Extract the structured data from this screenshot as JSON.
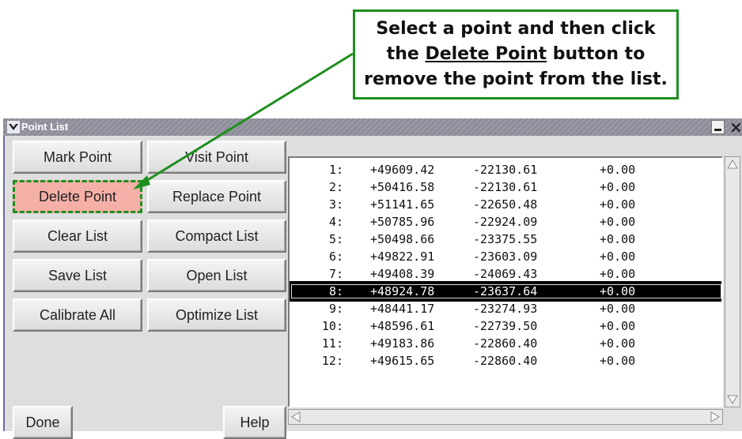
{
  "callout": {
    "line1": "Select a point and then click",
    "line2_before": "the ",
    "line2_link": "Delete Point",
    "line2_after": " button to",
    "line3": "remove the point from the list."
  },
  "window": {
    "title": "Point List",
    "close_glyph": "×"
  },
  "buttons": {
    "mark_point": "Mark Point",
    "visit_point": "Visit Point",
    "delete_point": "Delete Point",
    "replace_point": "Replace Point",
    "clear_list": "Clear List",
    "compact_list": "Compact List",
    "save_list": "Save List",
    "open_list": "Open List",
    "calibrate_all": "Calibrate All",
    "optimize_list": "Optimize List",
    "done": "Done",
    "help": "Help"
  },
  "points": [
    {
      "idx": "1:",
      "x": "+49609.42",
      "y": "-22130.61",
      "z": "+0.00"
    },
    {
      "idx": "2:",
      "x": "+50416.58",
      "y": "-22130.61",
      "z": "+0.00"
    },
    {
      "idx": "3:",
      "x": "+51141.65",
      "y": "-22650.48",
      "z": "+0.00"
    },
    {
      "idx": "4:",
      "x": "+50785.96",
      "y": "-22924.09",
      "z": "+0.00"
    },
    {
      "idx": "5:",
      "x": "+50498.66",
      "y": "-23375.55",
      "z": "+0.00"
    },
    {
      "idx": "6:",
      "x": "+49822.91",
      "y": "-23603.09",
      "z": "+0.00"
    },
    {
      "idx": "7:",
      "x": "+49408.39",
      "y": "-24069.43",
      "z": "+0.00"
    },
    {
      "idx": "8:",
      "x": "+48924.78",
      "y": "-23637.64",
      "z": "+0.00"
    },
    {
      "idx": "9:",
      "x": "+48441.17",
      "y": "-23274.93",
      "z": "+0.00"
    },
    {
      "idx": "10:",
      "x": "+48596.61",
      "y": "-22739.50",
      "z": "+0.00"
    },
    {
      "idx": "11:",
      "x": "+49183.86",
      "y": "-22860.40",
      "z": "+0.00"
    },
    {
      "idx": "12:",
      "x": "+49615.65",
      "y": "-22860.40",
      "z": "+0.00"
    }
  ],
  "selected_point": "8:",
  "colors": {
    "callout_border": "#1e8f1e",
    "highlight_fill": "#f4b0a7",
    "selection_bg": "#000000"
  }
}
